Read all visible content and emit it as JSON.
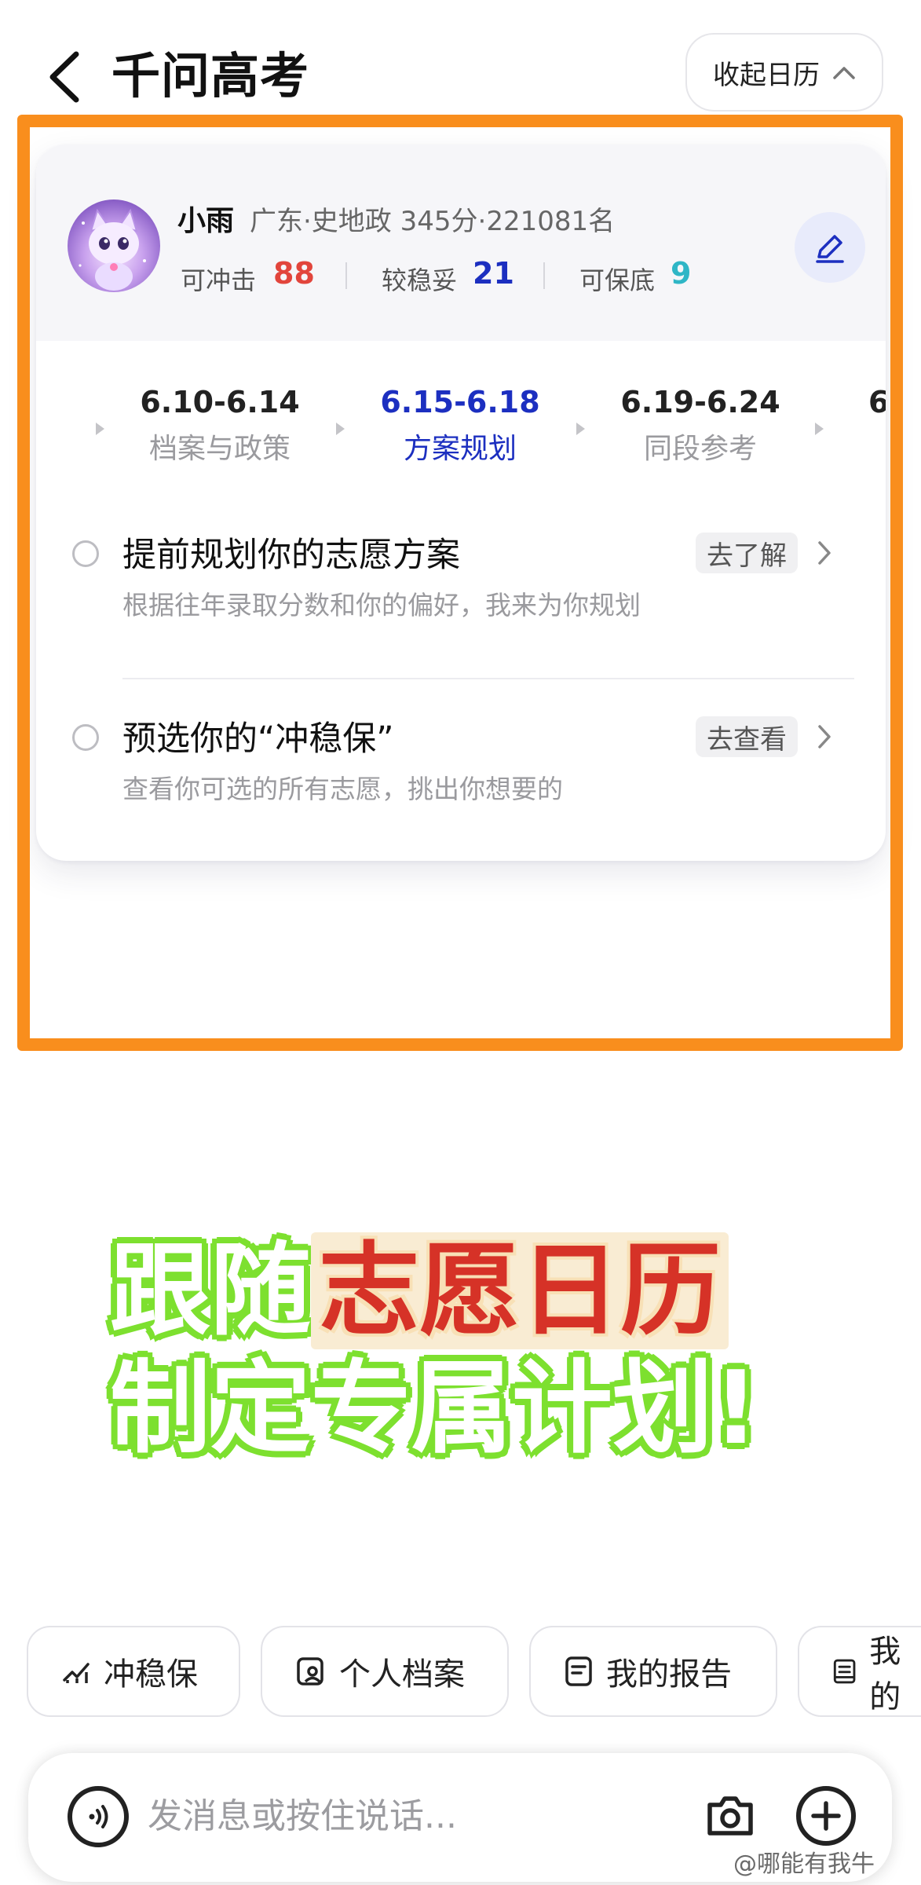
{
  "header": {
    "title": "千问高考",
    "collapse_label": "收起日历"
  },
  "profile": {
    "name": "小雨",
    "info": "广东·史地政 345分·221081名",
    "stats": [
      {
        "label": "可冲击",
        "value": "88",
        "color": "#e2453c"
      },
      {
        "label": "较稳妥",
        "value": "21",
        "color": "#1c2fc0"
      },
      {
        "label": "可保底",
        "value": "9",
        "color": "#2fb6c6"
      }
    ]
  },
  "timeline": [
    {
      "date": "6.10-6.14",
      "title": "档案与政策",
      "active": false
    },
    {
      "date": "6.15-6.18",
      "title": "方案规划",
      "active": true
    },
    {
      "date": "6.19-6.24",
      "title": "同段参考",
      "active": false
    },
    {
      "date": "6",
      "title": "",
      "active": false
    }
  ],
  "tasks": [
    {
      "title": "提前规划你的志愿方案",
      "desc": "根据往年录取分数和你的偏好，我来为你规划",
      "button": "去了解"
    },
    {
      "title": "预选你的“冲稳保”",
      "desc": "查看你可选的所有志愿，挑出你想要的",
      "button": "去查看"
    }
  ],
  "promo": {
    "line1_prefix": "跟随",
    "line1_highlight": "志愿日历",
    "line2": "制定专属计划!"
  },
  "chips": [
    {
      "label": "冲稳保",
      "icon": "chart-icon"
    },
    {
      "label": "个人档案",
      "icon": "profile-icon"
    },
    {
      "label": "我的报告",
      "icon": "report-icon"
    },
    {
      "label": "我的",
      "icon": "document-icon"
    }
  ],
  "input": {
    "placeholder": "发消息或按住说话..."
  },
  "watermark": "@哪能有我牛",
  "colors": {
    "accent_blue": "#1c2fc0",
    "highlight_orange": "#f98e1d",
    "promo_green": "#7de02f",
    "promo_red": "#d63227"
  }
}
